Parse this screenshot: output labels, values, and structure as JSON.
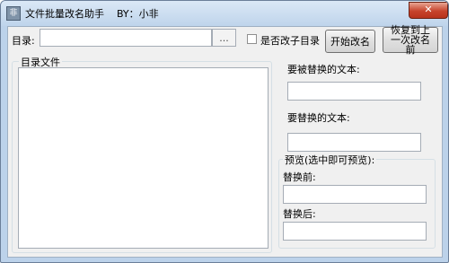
{
  "window": {
    "title": "文件批量改名助手    BY：小非",
    "icon_glyph": "非",
    "close_glyph": "✕"
  },
  "toolbar": {
    "dir_label": "目录:",
    "dir_value": "",
    "browse_label": "...",
    "subdir_checkbox_label": "是否改子目录",
    "subdir_checked": false,
    "rename_button": "开始改名",
    "restore_button": "恢复到上一次改名前"
  },
  "file_list": {
    "group_title": "目录文件",
    "items": []
  },
  "replace": {
    "find_label": "要被替换的文本:",
    "find_value": "",
    "replace_label": "要替换的文本:",
    "replace_value": ""
  },
  "preview": {
    "group_title": "预览(选中即可预览):",
    "before_label": "替换前:",
    "before_value": "",
    "after_label": "替换后:",
    "after_value": ""
  }
}
